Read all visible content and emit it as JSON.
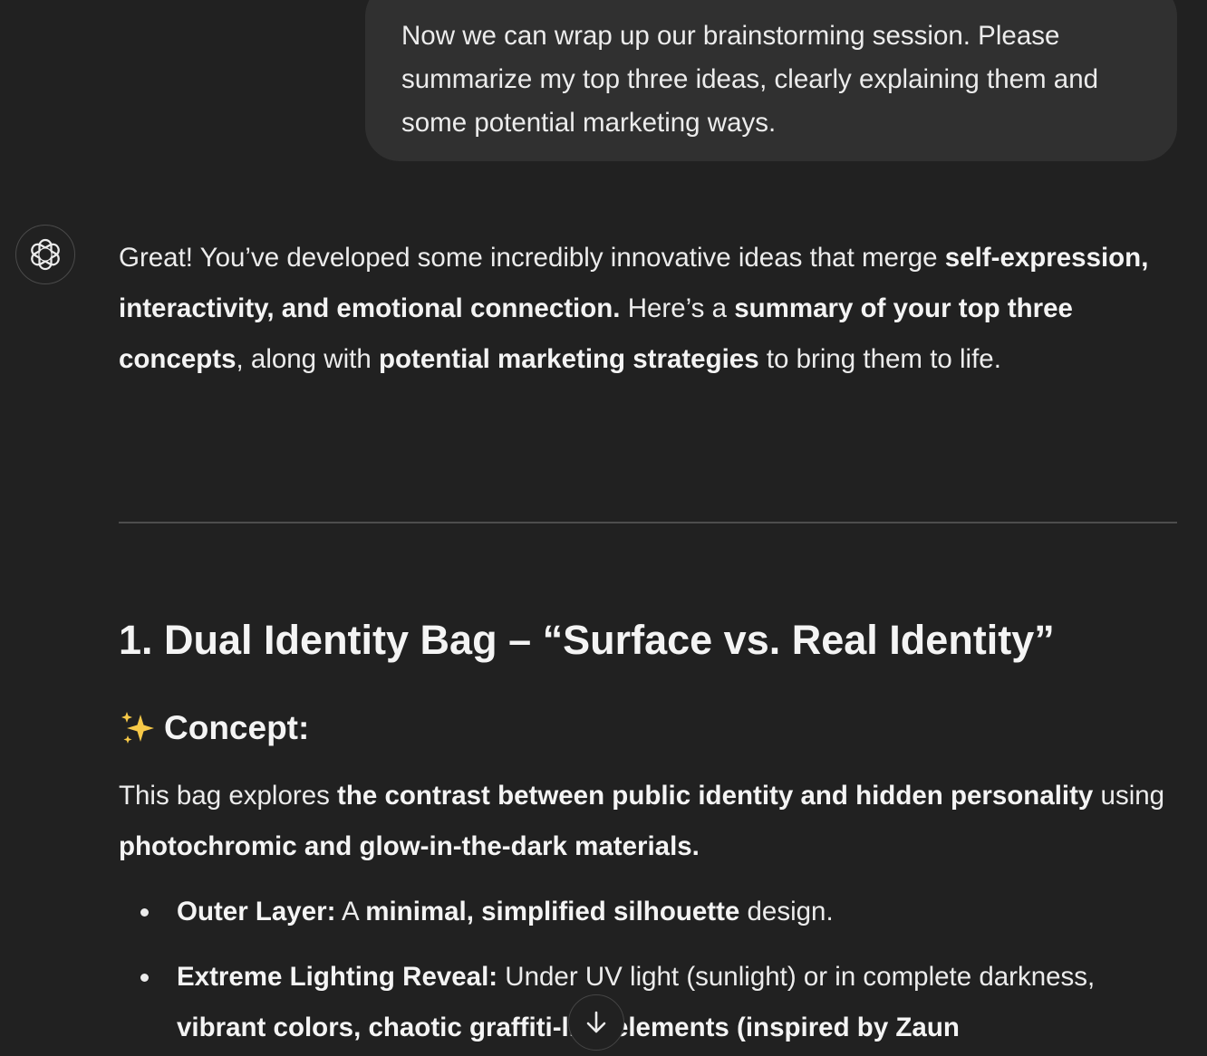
{
  "user_message": {
    "text": "Now we can wrap up our brainstorming session. Please summarize my top three ideas, clearly explaining them and some potential marketing ways."
  },
  "assistant": {
    "avatar_icon": "openai-logo-icon",
    "intro": {
      "p1": "Great! You’ve developed some incredibly innovative ideas that merge ",
      "b1": "self-expression, interactivity, and emotional connection.",
      "p2": " Here’s a ",
      "b2": "summary of your top three concepts",
      "p3": ", along with ",
      "b3": "potential marketing strategies",
      "p4": " to bring them to life."
    },
    "section1": {
      "heading": "1. Dual Identity Bag – “Surface vs. Real Identity”",
      "concept_icon": "sparkles-icon",
      "concept_label": "Concept:",
      "concept": {
        "p1": "This bag explores ",
        "b1": "the contrast between public identity and hidden personality",
        "p2": " using ",
        "b2": "photochromic and glow-in-the-dark materials."
      },
      "bullets": [
        {
          "b1": "Outer Layer:",
          "p1": " A ",
          "b2": "minimal, simplified silhouette",
          "p2": " design."
        },
        {
          "b1": "Extreme Lighting Reveal:",
          "p1": " Under UV light (sunlight) or in complete darkness, ",
          "b2": "vibrant colors, chaotic graffiti-like elements (inspired by Zaun"
        }
      ]
    }
  },
  "scroll_button": {
    "icon": "arrow-down-icon"
  },
  "colors": {
    "background": "#212121",
    "user_bubble": "#303030",
    "text": "#ececec",
    "divider": "#4d4d4d"
  }
}
